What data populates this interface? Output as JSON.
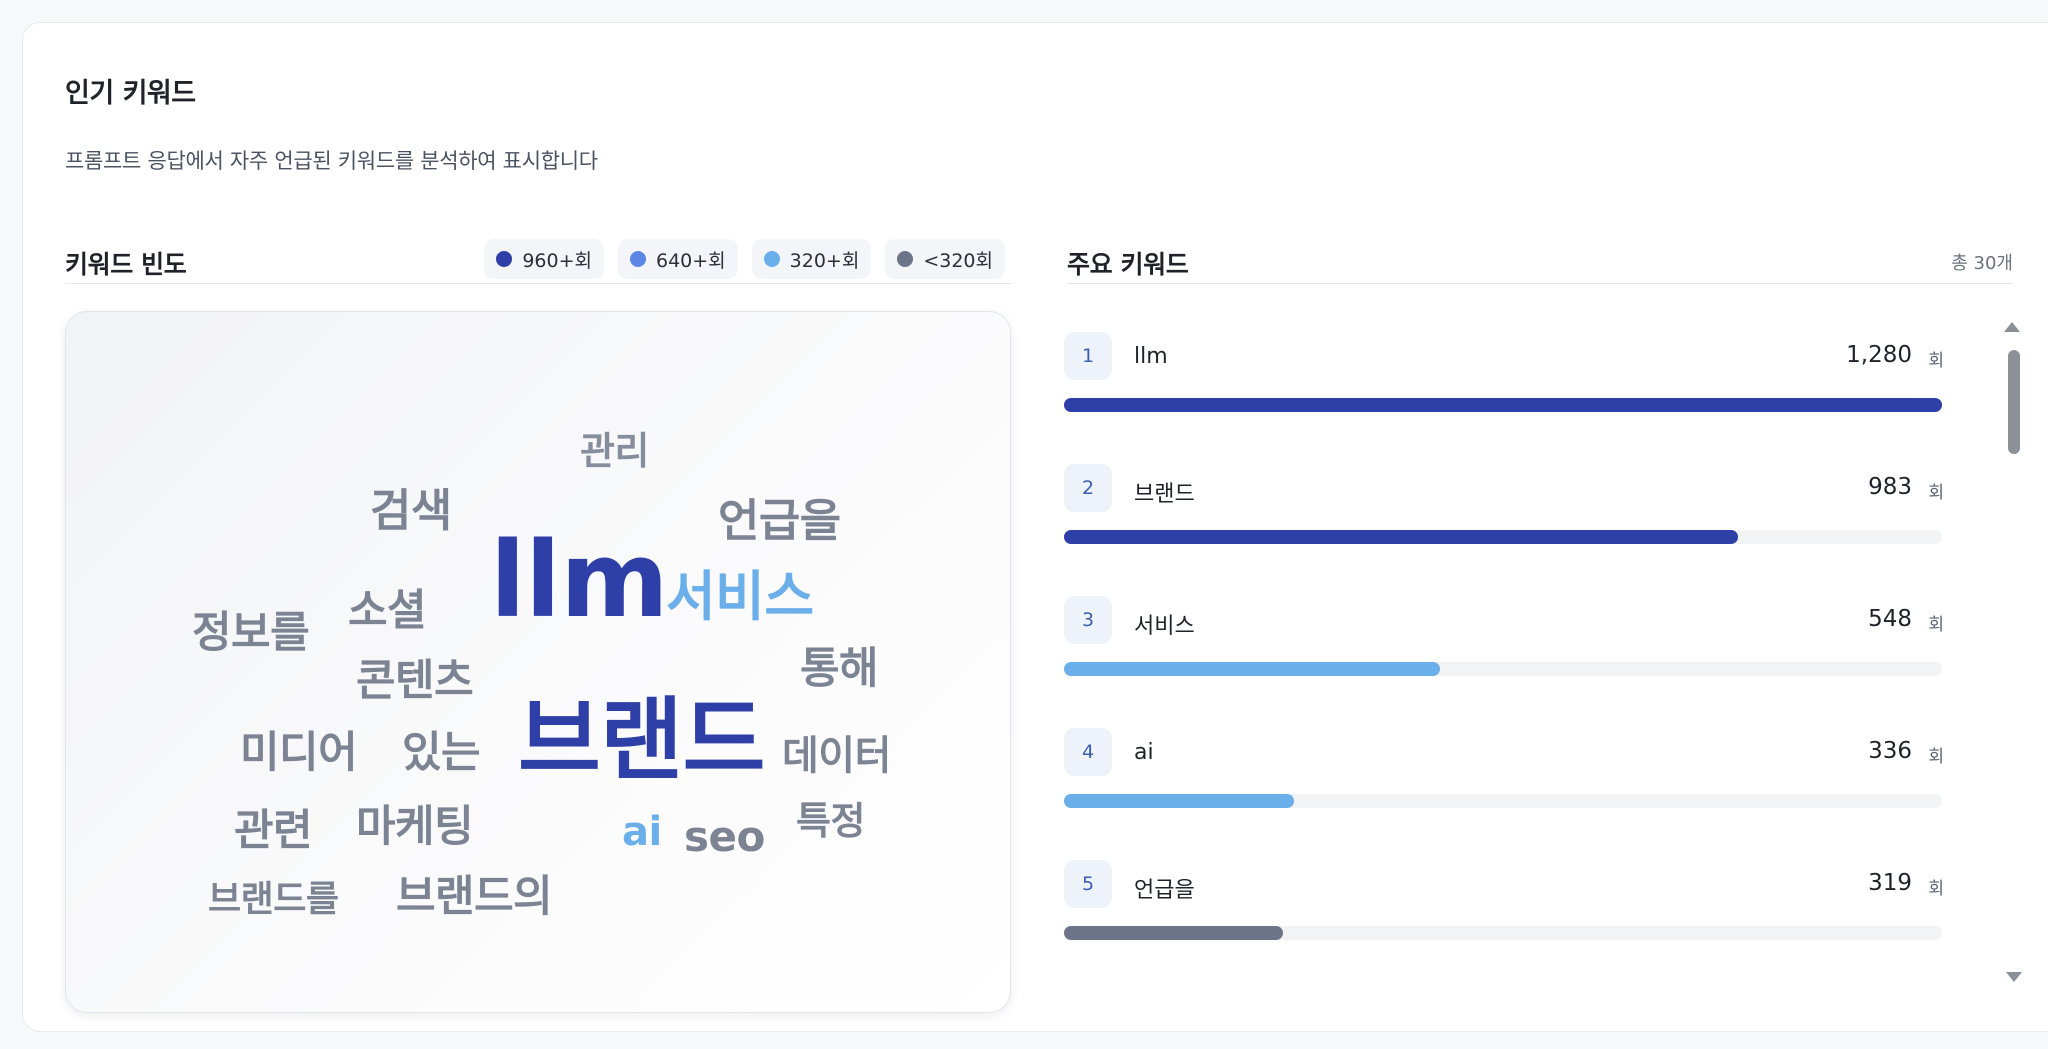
{
  "title": "인기 키워드",
  "subtitle": "프롬프트 응답에서 자주 언급된 키워드를 분석하여 표시합니다",
  "frequency": {
    "title": "키워드 빈도",
    "legend": [
      {
        "label": "960+회",
        "color": "#2f3fa8"
      },
      {
        "label": "640+회",
        "color": "#5b86e5"
      },
      {
        "label": "320+회",
        "color": "#6aaeea"
      },
      {
        "label": "<320회",
        "color": "#6b7489"
      }
    ],
    "words": [
      {
        "text": "관리",
        "color": "#868d9c"
      },
      {
        "text": "검색",
        "color": "#7c8494"
      },
      {
        "text": "언급을",
        "color": "#7c8494"
      },
      {
        "text": "llm",
        "color": "#2f3fa8"
      },
      {
        "text": "서비스",
        "color": "#6aaeea"
      },
      {
        "text": "소셜",
        "color": "#7c8494"
      },
      {
        "text": "정보를",
        "color": "#7c8494"
      },
      {
        "text": "통해",
        "color": "#7c8494"
      },
      {
        "text": "콘텐츠",
        "color": "#7c8494"
      },
      {
        "text": "미디어",
        "color": "#7c8494"
      },
      {
        "text": "있는",
        "color": "#7c8494"
      },
      {
        "text": "브랜드",
        "color": "#2f3fa8"
      },
      {
        "text": "데이터",
        "color": "#7c8494"
      },
      {
        "text": "특정",
        "color": "#7c8494"
      },
      {
        "text": "관련",
        "color": "#7c8494"
      },
      {
        "text": "마케팅",
        "color": "#7c8494"
      },
      {
        "text": "ai",
        "color": "#6aaeea"
      },
      {
        "text": "seo",
        "color": "#7c8494"
      },
      {
        "text": "브랜드를",
        "color": "#7c8494"
      },
      {
        "text": "브랜드의",
        "color": "#7c8494"
      }
    ]
  },
  "major": {
    "title": "주요 키워드",
    "total": "총 30개",
    "unit": "회",
    "max": 1280,
    "items": [
      {
        "rank": "1",
        "name": "llm",
        "count": "1,280",
        "value": 1280,
        "color": "#2f3fa8"
      },
      {
        "rank": "2",
        "name": "브랜드",
        "count": "983",
        "value": 983,
        "color": "#2f3fa8"
      },
      {
        "rank": "3",
        "name": "서비스",
        "count": "548",
        "value": 548,
        "color": "#6aaeea"
      },
      {
        "rank": "4",
        "name": "ai",
        "count": "336",
        "value": 336,
        "color": "#6aaeea"
      },
      {
        "rank": "5",
        "name": "언급을",
        "count": "319",
        "value": 319,
        "color": "#6b7489"
      }
    ]
  }
}
